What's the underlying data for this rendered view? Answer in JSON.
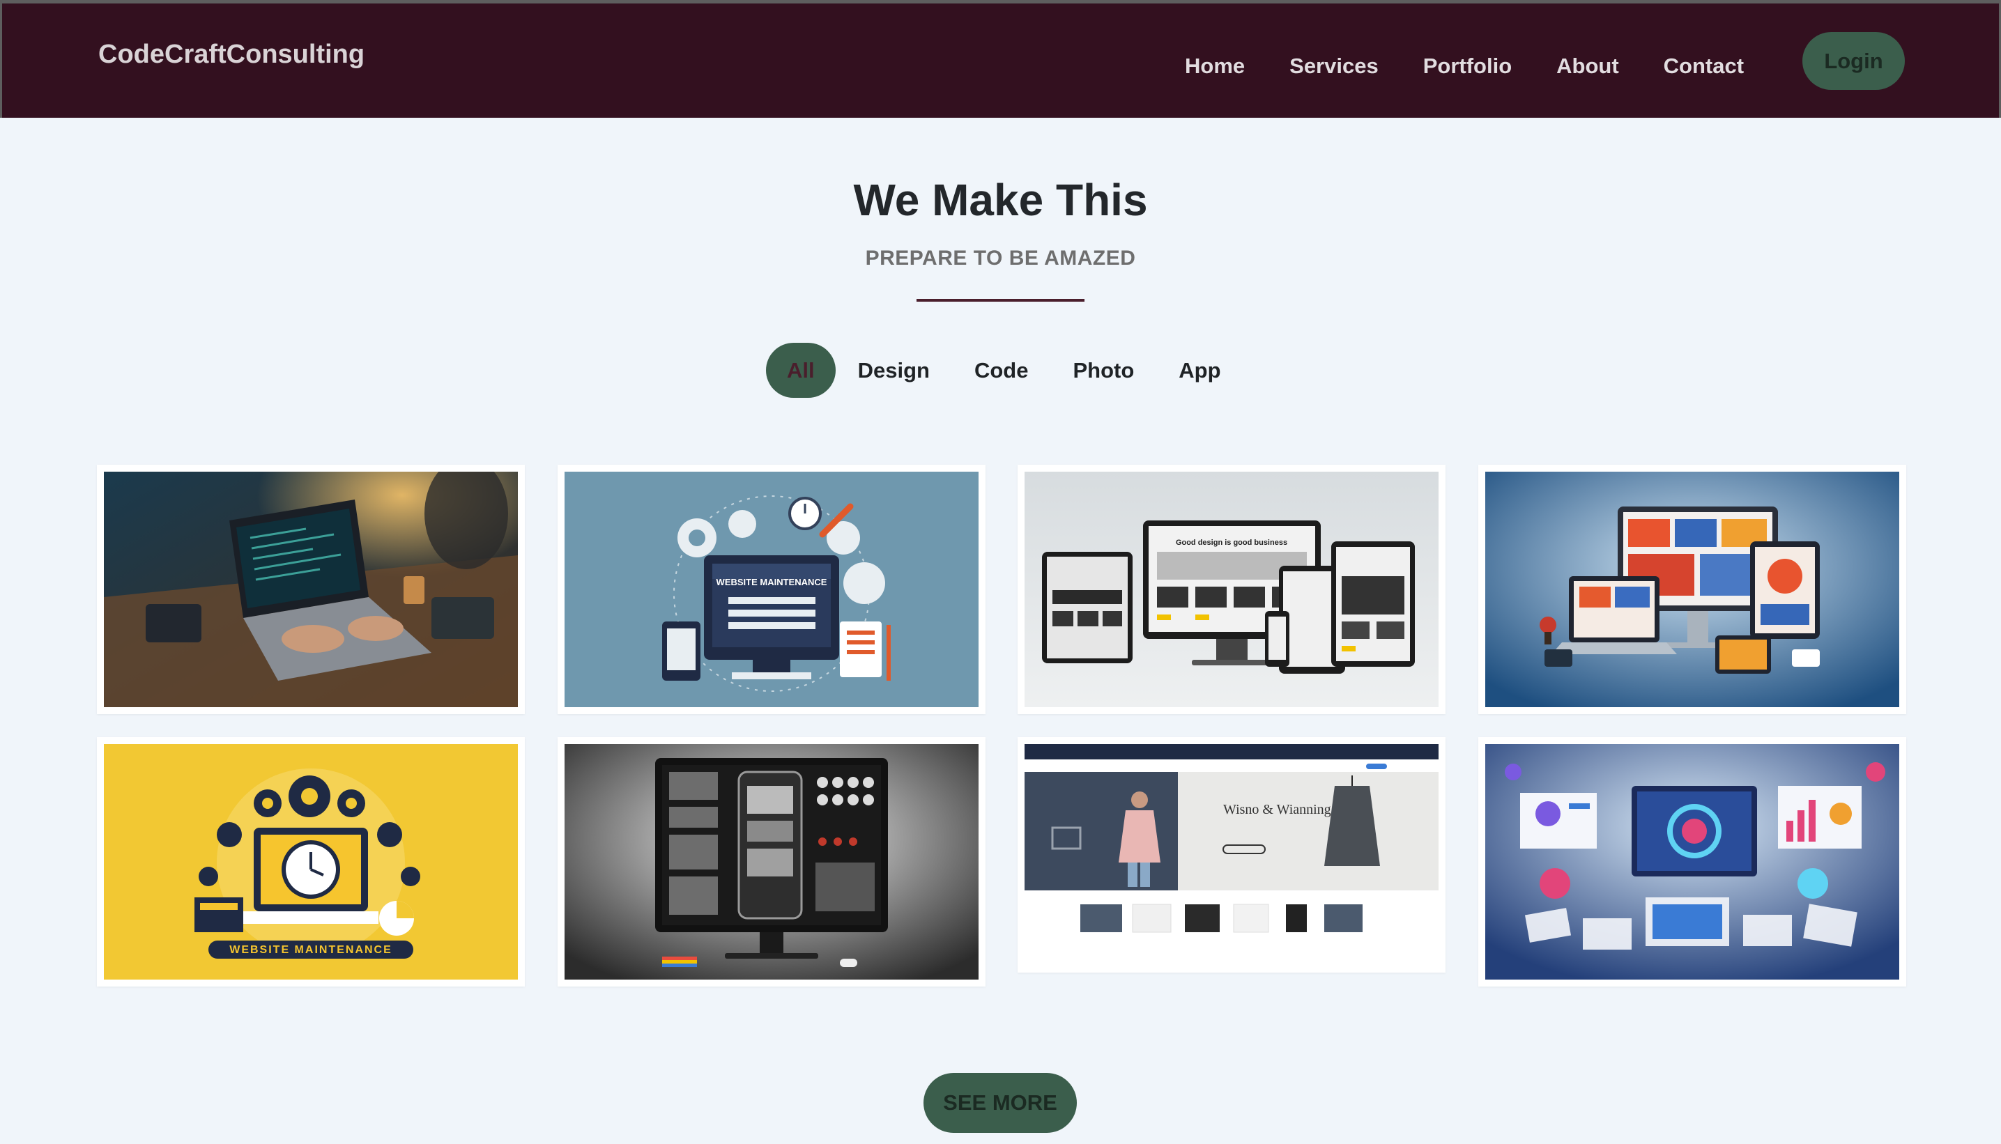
{
  "brand": {
    "name": "CodeCraftConsulting"
  },
  "nav": {
    "items": [
      "Home",
      "Services",
      "Portfolio",
      "About",
      "Contact"
    ],
    "login_label": "Login"
  },
  "portfolio": {
    "title": "We Make This",
    "subtitle": "PREPARE TO BE AMAZED",
    "filters": [
      "All",
      "Design",
      "Code",
      "Photo",
      "App"
    ],
    "active_filter": "All",
    "items": [
      {
        "caption": "",
        "icon": "laptop-coding-photo-icon"
      },
      {
        "caption": "WEBSITE MAINTENANCE",
        "icon": "website-maintenance-blue-icon"
      },
      {
        "caption": "Good design is good business",
        "icon": "responsive-devices-icon"
      },
      {
        "caption": "",
        "icon": "devices-showcase-icon"
      },
      {
        "caption": "WEBSITE MAINTENANCE",
        "icon": "website-maintenance-yellow-icon"
      },
      {
        "caption": "",
        "icon": "ui-mockup-monitor-icon"
      },
      {
        "caption": "Wisno & Wianning",
        "icon": "fashion-store-site-icon"
      },
      {
        "caption": "",
        "icon": "dashboard-collage-icon"
      }
    ],
    "see_more_label": "SEE MORE"
  },
  "colors": {
    "nav_bg": "#33101f",
    "page_bg": "#f0f5fa",
    "accent": "#3b5e4c",
    "divider": "#4a1e2c"
  }
}
